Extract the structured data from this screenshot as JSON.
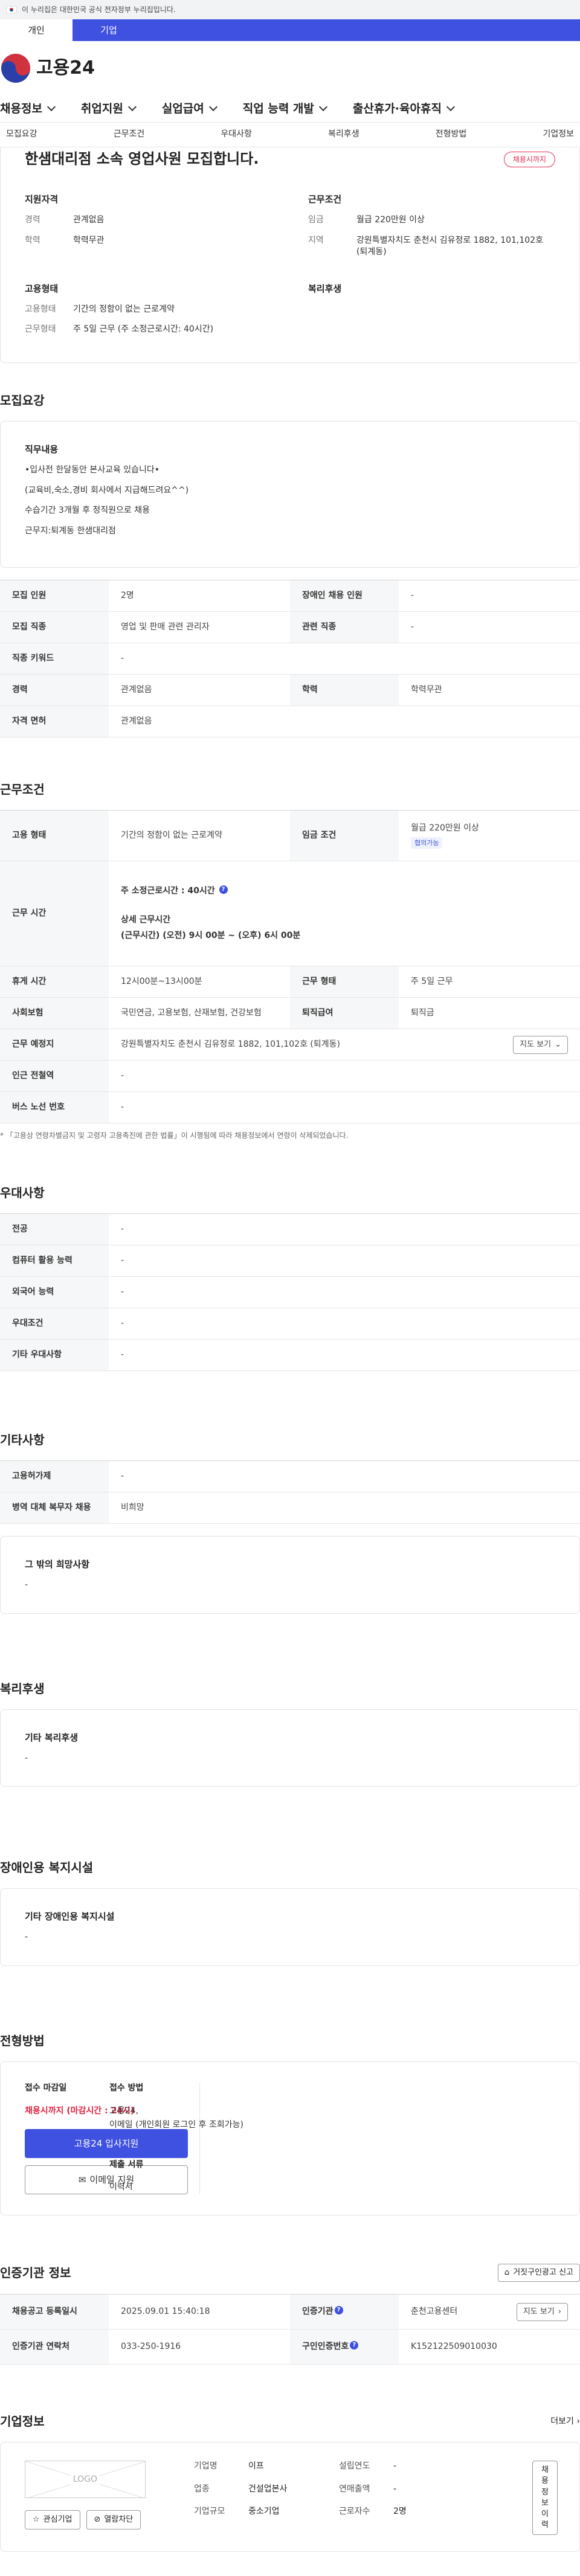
{
  "gov_banner": "이 누리집은 대한민국 공식 전자정부 누리집입니다.",
  "user_tabs": [
    "개인",
    "기업"
  ],
  "logo_text": "고용24",
  "gnb": [
    "채용정보",
    "취업지원",
    "실업급여",
    "직업 능력 개발",
    "출산휴가·육아휴직"
  ],
  "subnav": [
    "모집요강",
    "근무조건",
    "우대사항",
    "복리후생",
    "전형방법",
    "기업정보"
  ],
  "job": {
    "title": "한샘대리점 소속 영업사원 모집합니다.",
    "deadline_badge": "채용시까지",
    "summary": {
      "qualification_title": "지원자격",
      "career_label": "경력",
      "career": "관계없음",
      "edu_label": "학력",
      "edu": "학력무관",
      "work_title": "근무조건",
      "wage_label": "임금",
      "wage": "월급 220만원 이상",
      "region_label": "지역",
      "region": "강원특별자치도 춘천시 김유정로 1882, 101,102호 (퇴계동)",
      "employ_title": "고용형태",
      "employ_label": "고용형태",
      "employ": "기간의 정함이 없는 근로계약",
      "hours_label": "근무형태",
      "hours": "주 5일 근무 (주 소정근로시간: 40시간)",
      "welfare_title": "복리후생"
    }
  },
  "recruit": {
    "title": "모집요강",
    "duty_title": "직무내용",
    "duty_lines": [
      "•입사전 한달동안 본사교육 있습니다•",
      "(교육비,숙소,경비 회사에서 지급해드려요^^)",
      "수습기간 3개월 후 정직원으로 채용",
      "근무지:퇴계동 한샘대리점"
    ],
    "rows": [
      {
        "k1": "모집 인원",
        "v1": "2명",
        "k2": "장애인 채용 인원",
        "v2": "-"
      },
      {
        "k1": "모집 직종",
        "v1": "영업 및 판매 관련 관리자",
        "k2": "관련 직종",
        "v2": "-"
      },
      {
        "k1": "직종 키워드",
        "v1": "-",
        "k2": "",
        "v2": ""
      },
      {
        "k1": "경력",
        "v1": "관계없음",
        "k2": "학력",
        "v2": "학력무관"
      },
      {
        "k1": "자격 면허",
        "v1": "관계없음",
        "k2": "",
        "v2": ""
      }
    ]
  },
  "conditions": {
    "title": "근무조건",
    "employ_k": "고용 형태",
    "employ_v": "기간의 정함이 없는 근로계약",
    "wage_k": "임금 조건",
    "wage_v": "월급 220만원 이상",
    "wage_tag": "협의가능",
    "hours_k": "근무 시간",
    "hours_week": "주 소정근로시간 : 40시간",
    "hours_detail_title": "상세 근무시간",
    "hours_detail": "(근무시간) (오전) 9시 00분 ~ (오후) 6시 00분",
    "break_k": "휴게 시간",
    "break_v": "12시00분~13시00분",
    "type_k": "근무 형태",
    "type_v": "주 5일 근무",
    "ins_k": "사회보험",
    "ins_v": "국민연금, 고용보험, 산재보험, 건강보험",
    "retire_k": "퇴직급여",
    "retire_v": "퇴직금",
    "loc_k": "근무 예정지",
    "loc_v": "강원특별자치도 춘천시 김유정로 1882, 101,102호 (퇴계동)",
    "map_btn": "지도 보기",
    "subway_k": "인근 전철역",
    "subway_v": "-",
    "bus_k": "버스 노선 번호",
    "bus_v": "-",
    "note": "* 「고용상 연령차별금지 및 고령자 고용촉진에 관한 법률」이 시행됨에 따라 채용정보에서 연령이 삭제되었습니다."
  },
  "preference": {
    "title": "우대사항",
    "rows": [
      [
        "전공",
        "-"
      ],
      [
        "컴퓨터 활용 능력",
        "-"
      ],
      [
        "외국어 능력",
        "-"
      ],
      [
        "우대조건",
        "-"
      ],
      [
        "기타 우대사항",
        "-"
      ]
    ]
  },
  "etc": {
    "title": "기타사항",
    "rows": [
      [
        "고용허가제",
        "-"
      ],
      [
        "병역 대체 복무자 채용",
        "비희망"
      ]
    ],
    "other_title": "그 밖의 희망사항",
    "other_value": "-"
  },
  "welfare": {
    "title": "복리후생",
    "box_title": "기타 복리후생",
    "box_value": "-"
  },
  "disability": {
    "title": "장애인용 복지시설",
    "box_title": "기타 장애인용 복지시설",
    "box_value": "-"
  },
  "selection": {
    "title": "전형방법",
    "deadline_label": "접수 마감일",
    "deadline_value": "채용시까지 (마감시간 : 24시)",
    "apply_btn": "고용24 입사지원",
    "email_btn": "이메일 지원",
    "method_label": "접수 방법",
    "method_lines": [
      "고용24,",
      "이메일 (개인회원 로그인 후 조회가능)"
    ],
    "docs_label": "제출 서류",
    "docs_value": "이력서"
  },
  "cert": {
    "title": "인증기관 정보",
    "report_btn": "거짓구인광고 신고",
    "reg_k": "채용공고 등록일시",
    "reg_v": "2025.09.01 15:40:18",
    "org_k": "인증기관",
    "org_v": "춘천고용센터",
    "map_btn": "지도 보기",
    "tel_k": "인증기관 연락처",
    "tel_v": "033-250-1916",
    "id_k": "구인인증번호",
    "id_v": "K152122509010030"
  },
  "company": {
    "title": "기업정보",
    "more": "더보기",
    "logo_placeholder": "LOGO",
    "interest_btn": "관심기업",
    "block_btn": "열람차단",
    "name_k": "기업명",
    "name_v": "이프",
    "year_k": "설립연도",
    "year_v": "-",
    "biz_k": "업종",
    "biz_v": "건설업본사",
    "sales_k": "연매출액",
    "sales_v": "-",
    "size_k": "기업규모",
    "size_v": "중소기업",
    "emp_k": "근로자수",
    "emp_v": "2명",
    "jobs_btn": "채용정보 이력"
  }
}
